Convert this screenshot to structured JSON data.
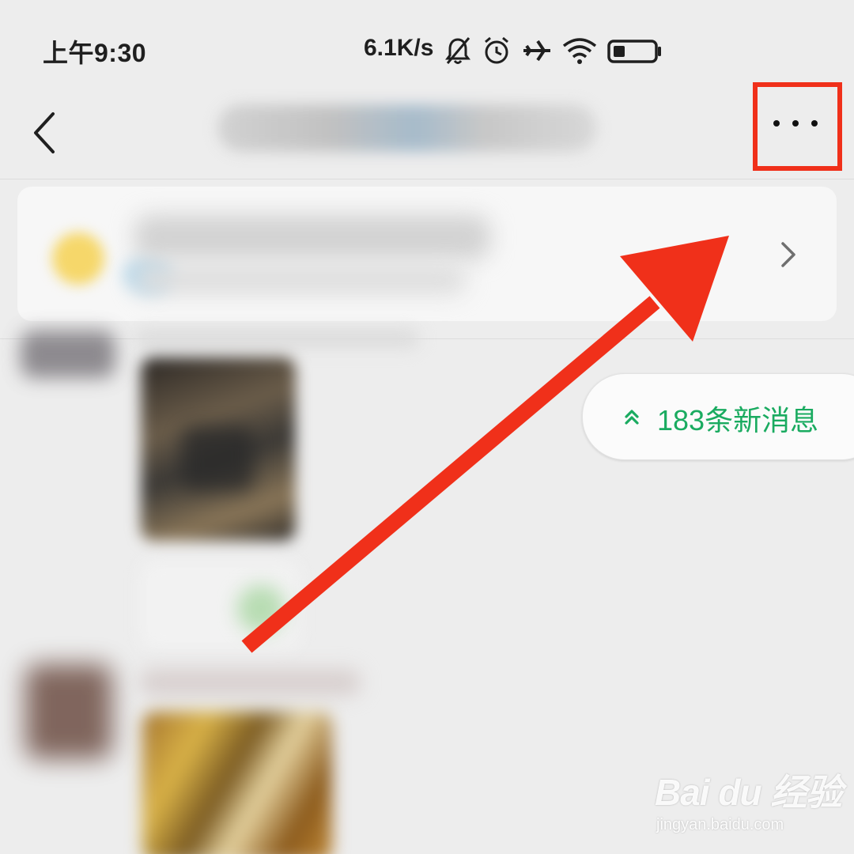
{
  "status_bar": {
    "time": "上午9:30",
    "network_speed": "6.1K/s",
    "icons": [
      "bell-muted-icon",
      "alarm-icon",
      "airplane-icon",
      "wifi-icon",
      "battery-icon"
    ]
  },
  "nav_bar": {
    "back_icon": "chevron-left-icon",
    "more_icon": "more-dots-icon"
  },
  "notice_card": {
    "chevron_icon": "chevron-right-icon"
  },
  "new_messages": {
    "label": "183条新消息",
    "icon": "double-chevron-up-icon"
  },
  "watermark": {
    "logo": "Bai du 经验",
    "url": "jingyan.baidu.com"
  },
  "colors": {
    "background": "#ededed",
    "accent_green": "#1aab60",
    "annotation_red": "#f0301a"
  }
}
